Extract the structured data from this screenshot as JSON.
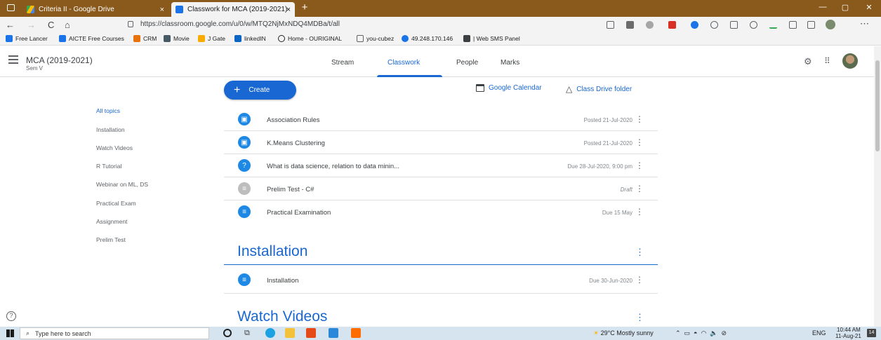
{
  "browser": {
    "tabs": [
      {
        "label": "Criteria II - Google Drive",
        "close": "×",
        "active": false
      },
      {
        "label": "Classwork for MCA (2019-2021)",
        "close": "×",
        "active": true
      }
    ],
    "new_tab": "+",
    "window_controls": {
      "minimize": "—",
      "maximize": "▢",
      "close": "✕"
    },
    "url": "https://classroom.google.com/u/0/w/MTQ2NjMxNDQ4MDBa/t/all",
    "nav": {
      "back": "←",
      "forward": "→",
      "reload": "C",
      "home": "⌂"
    },
    "bookmarks": [
      "Free Lancer",
      "AICTE Free Courses",
      "CRM",
      "Movie",
      "J Gate",
      "linkedIN",
      "Home - OURIGINAL",
      "you-cubez",
      "49.248.170.146",
      "| Web SMS Panel"
    ]
  },
  "header": {
    "class_name": "MCA (2019-2021)",
    "class_section": "Sem V",
    "tabs": [
      "Stream",
      "Classwork",
      "People",
      "Marks"
    ],
    "active_tab": "Classwork"
  },
  "toolbar": {
    "create_label": "Create",
    "calendar_label": "Google Calendar",
    "drive_label": "Class Drive folder"
  },
  "topics": [
    "All topics",
    "Installation",
    "Watch Videos",
    "R Tutorial",
    "Webinar on ML, DS",
    "Practical Exam",
    "Assignment",
    "Prelim Test"
  ],
  "items": [
    {
      "title": "Association Rules",
      "meta": "Posted 21-Jul-2020",
      "icon": "material-icon"
    },
    {
      "title": "K.Means Clustering",
      "meta": "Posted 21-Jul-2020",
      "icon": "material-icon"
    },
    {
      "title": "What is data science, relation to data minin...",
      "meta": "Due 28-Jul-2020, 9:00 pm",
      "icon": "question-icon"
    },
    {
      "title": "Prelim Test - C#",
      "meta": "Draft",
      "icon": "assignment-icon"
    },
    {
      "title": "Practical Examination",
      "meta": "Due 15 May",
      "icon": "assignment-icon"
    }
  ],
  "sections": [
    {
      "title": "Installation",
      "items": [
        {
          "title": "Installation",
          "meta": "Due 30-Jun-2020",
          "icon": "assignment-icon"
        }
      ]
    },
    {
      "title": "Watch Videos"
    }
  ],
  "taskbar": {
    "search_placeholder": "Type here to search",
    "weather": "29°C  Mostly sunny",
    "lang": "ENG",
    "time": "10:44 AM",
    "date": "11-Aug-21",
    "notifications": "14"
  },
  "colors": {
    "accent": "#1967d2",
    "icon_blue": "#1e88e5",
    "tabstrip": "#8a5a1c"
  }
}
